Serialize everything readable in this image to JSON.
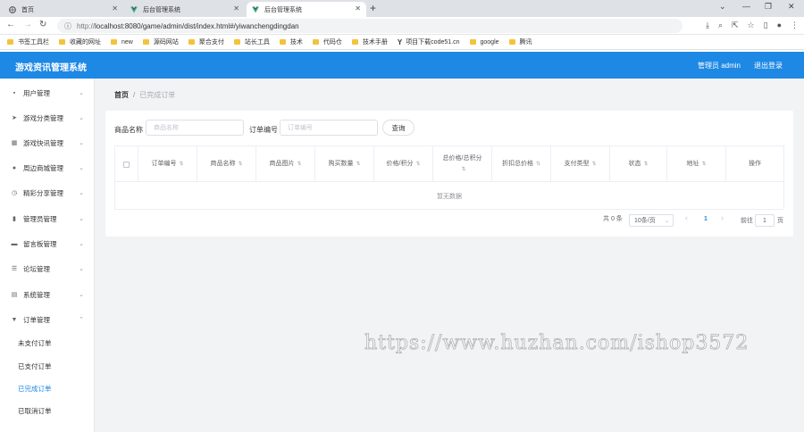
{
  "browser": {
    "tabs": [
      {
        "label": "首页"
      },
      {
        "label": "后台管理系统"
      },
      {
        "label": "后台管理系统"
      }
    ],
    "url_prefix": "http://",
    "url": "localhost:8080/game/admin/dist/index.html#/yiwanchengdingdan",
    "bookmarks": [
      "书签工具栏",
      "收藏的网址",
      "new",
      "源码网站",
      "聚合支付",
      "站长工具",
      "技术",
      "代码仓",
      "技术手册",
      "项目下载code51.cn",
      "google",
      "腾讯"
    ]
  },
  "header": {
    "title": "游戏资讯管理系统",
    "user": "管理员 admin",
    "logout": "退出登录"
  },
  "sidebar": {
    "items": [
      {
        "label": "用户管理",
        "icon": "user-icon"
      },
      {
        "label": "游戏分类管理",
        "icon": "send-icon"
      },
      {
        "label": "游戏快讯管理",
        "icon": "grid-icon"
      },
      {
        "label": "周边商城管理",
        "icon": "person-icon"
      },
      {
        "label": "精彩分享管理",
        "icon": "clock-icon"
      },
      {
        "label": "管理员管理",
        "icon": "chart-icon"
      },
      {
        "label": "留言板管理",
        "icon": "message-icon"
      },
      {
        "label": "论坛管理",
        "icon": "sliders-icon"
      },
      {
        "label": "系统管理",
        "icon": "system-icon"
      },
      {
        "label": "订单管理",
        "icon": "cup-icon"
      }
    ],
    "sub_items": [
      {
        "label": "未支付订单"
      },
      {
        "label": "已支付订单"
      },
      {
        "label": "已完成订单"
      },
      {
        "label": "已取消订单"
      }
    ]
  },
  "main": {
    "breadcrumb": {
      "home": "首页",
      "sep": "/",
      "current": "已完成订单"
    },
    "search": {
      "name_label": "商品名称",
      "name_placeholder": "商品名称",
      "order_label": "订单编号",
      "order_placeholder": "订单编号",
      "query_button": "查询"
    },
    "table": {
      "columns": [
        "订单编号",
        "商品名称",
        "商品图片",
        "购买数量",
        "价格/积分",
        "总价格/总积分",
        "折扣总价格",
        "支付类型",
        "状态",
        "地址",
        "操作"
      ],
      "empty_text": "暂无数据"
    },
    "pagination": {
      "total": "共 0 条",
      "page_size": "10条/页",
      "prev": "‹",
      "current_page": "1",
      "next": "›",
      "goto_label": "前往",
      "goto_value": "1",
      "goto_suffix": "页"
    }
  },
  "watermark": "https://www.huzhan.com/ishop3572",
  "colors": {
    "accent": "#1e88e5",
    "background": "#f2f3f5"
  }
}
